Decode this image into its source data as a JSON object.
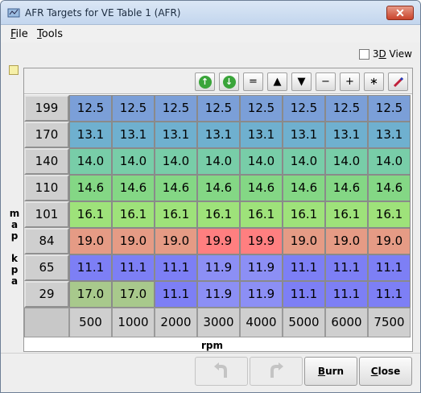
{
  "window": {
    "title": "AFR Targets for VE Table 1 (AFR)",
    "close_glyph": "✕"
  },
  "menu": {
    "file": {
      "mnemonic": "F",
      "rest": "ile"
    },
    "tools": {
      "mnemonic": "T",
      "rest": "ools"
    }
  },
  "view3d": {
    "pre": "3",
    "mnemonic": "D",
    "rest": " View",
    "checked": false
  },
  "axis": {
    "y_label": "map kpa",
    "x_label": "rpm"
  },
  "toolbar": {
    "buttons": [
      {
        "name": "increase-icon",
        "glyph": "↑"
      },
      {
        "name": "decrease-icon",
        "glyph": "↓"
      },
      {
        "name": "set-equal-icon",
        "glyph": "="
      },
      {
        "name": "arrow-up-icon",
        "glyph": "▲"
      },
      {
        "name": "arrow-down-icon",
        "glyph": "▼"
      },
      {
        "name": "minus-icon",
        "glyph": "−"
      },
      {
        "name": "plus-icon",
        "glyph": "+"
      },
      {
        "name": "multiply-icon",
        "glyph": "∗"
      },
      {
        "name": "interpolate-pen-icon",
        "glyph": ""
      }
    ]
  },
  "table": {
    "rows": [
      "199",
      "170",
      "140",
      "110",
      "101",
      "84",
      "65",
      "29"
    ],
    "cols": [
      "500",
      "1000",
      "2000",
      "3000",
      "4000",
      "5000",
      "6000",
      "7500"
    ],
    "values": [
      [
        "12.5",
        "12.5",
        "12.5",
        "12.5",
        "12.5",
        "12.5",
        "12.5",
        "12.5"
      ],
      [
        "13.1",
        "13.1",
        "13.1",
        "13.1",
        "13.1",
        "13.1",
        "13.1",
        "13.1"
      ],
      [
        "14.0",
        "14.0",
        "14.0",
        "14.0",
        "14.0",
        "14.0",
        "14.0",
        "14.0"
      ],
      [
        "14.6",
        "14.6",
        "14.6",
        "14.6",
        "14.6",
        "14.6",
        "14.6",
        "14.6"
      ],
      [
        "16.1",
        "16.1",
        "16.1",
        "16.1",
        "16.1",
        "16.1",
        "16.1",
        "16.1"
      ],
      [
        "19.0",
        "19.0",
        "19.0",
        "19.9",
        "19.9",
        "19.0",
        "19.0",
        "19.0"
      ],
      [
        "11.1",
        "11.1",
        "11.1",
        "11.9",
        "11.9",
        "11.1",
        "11.1",
        "11.1"
      ],
      [
        "17.0",
        "17.0",
        "11.1",
        "11.9",
        "11.9",
        "11.1",
        "11.1",
        "11.1"
      ]
    ],
    "colors": [
      [
        "#7b9fd8",
        "#7b9fd8",
        "#7b9fd8",
        "#7b9fd8",
        "#7b9fd8",
        "#7b9fd8",
        "#7b9fd8",
        "#7b9fd8"
      ],
      [
        "#6fb0cf",
        "#6fb0cf",
        "#6fb0cf",
        "#6fb0cf",
        "#6fb0cf",
        "#6fb0cf",
        "#6fb0cf",
        "#6fb0cf"
      ],
      [
        "#78cda8",
        "#78cda8",
        "#78cda8",
        "#78cda8",
        "#78cda8",
        "#78cda8",
        "#78cda8",
        "#78cda8"
      ],
      [
        "#84d785",
        "#84d785",
        "#84d785",
        "#84d785",
        "#84d785",
        "#84d785",
        "#84d785",
        "#84d785"
      ],
      [
        "#9ee27a",
        "#9ee27a",
        "#9ee27a",
        "#9ee27a",
        "#9ee27a",
        "#9ee27a",
        "#9ee27a",
        "#9ee27a"
      ],
      [
        "#e59b85",
        "#e59b85",
        "#e59b85",
        "#ff7f80",
        "#ff7f80",
        "#e59b85",
        "#e59b85",
        "#e59b85"
      ],
      [
        "#7d7ff5",
        "#7d7ff5",
        "#7d7ff5",
        "#8c8ff5",
        "#8c8ff5",
        "#7d7ff5",
        "#7d7ff5",
        "#7d7ff5"
      ],
      [
        "#a8c98c",
        "#a8c98c",
        "#7d7ff5",
        "#8c8ff5",
        "#8c8ff5",
        "#7d7ff5",
        "#7d7ff5",
        "#7d7ff5"
      ]
    ]
  },
  "buttons": {
    "burn": {
      "mnemonic": "B",
      "rest": "urn"
    },
    "close": {
      "mnemonic": "C",
      "rest": "lose"
    }
  }
}
